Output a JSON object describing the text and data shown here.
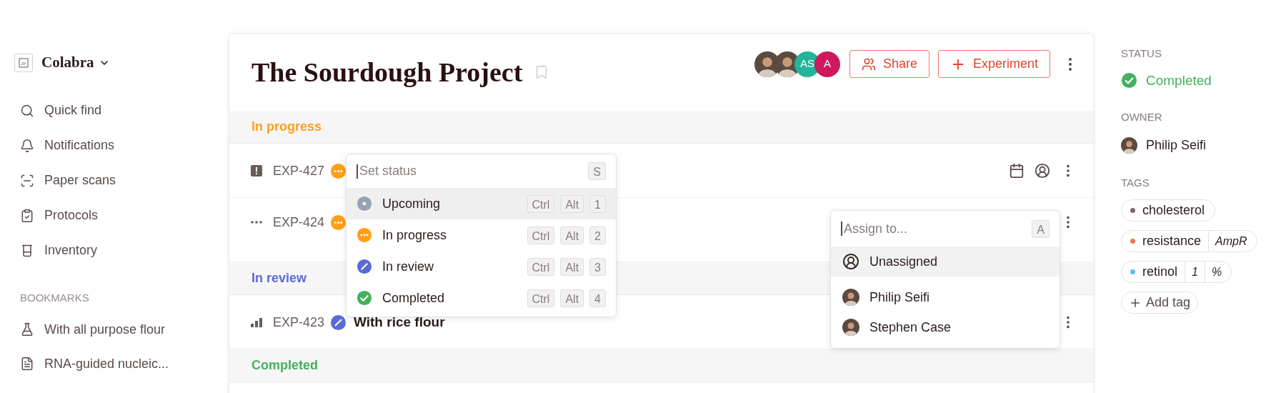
{
  "sidebar": {
    "workspace": "Colabra",
    "nav": [
      {
        "kind": "search",
        "label": "Quick find"
      },
      {
        "kind": "bell",
        "label": "Notifications"
      },
      {
        "kind": "scan",
        "label": "Paper scans"
      },
      {
        "kind": "clipboard",
        "label": "Protocols"
      },
      {
        "kind": "beaker",
        "label": "Inventory"
      }
    ],
    "bookmarks_heading": "BOOKMARKS",
    "bookmarks": [
      {
        "kind": "experiment",
        "label": "With all purpose flour"
      },
      {
        "kind": "document",
        "label": "RNA-guided nucleic..."
      }
    ]
  },
  "project": {
    "title": "The Sourdough Project",
    "bookmarked": false,
    "members": [
      {
        "kind": "photo"
      },
      {
        "kind": "photo"
      },
      {
        "kind": "initials",
        "initials": "AS",
        "color": "#22b59b"
      },
      {
        "kind": "initials",
        "initials": "A",
        "color": "#d0185f"
      }
    ],
    "buttons": [
      {
        "kind": "share",
        "label": "Share"
      },
      {
        "kind": "add",
        "label": "Experiment"
      }
    ]
  },
  "groups": [
    {
      "label": "In progress",
      "color": "#ff9f1a",
      "experiments": [
        {
          "priority": {
            "kind": "urgent"
          },
          "id": "EXP-427",
          "status": {
            "kind": "in_progress"
          },
          "quick_actions": true
        },
        {
          "priority": {
            "kind": "none"
          },
          "id": "EXP-424",
          "status": {
            "kind": "in_progress"
          }
        }
      ]
    },
    {
      "label": "In review",
      "color": "#5b6bd6",
      "experiments": [
        {
          "priority": {
            "kind": "medium"
          },
          "id": "EXP-423",
          "status": {
            "kind": "in_review"
          },
          "title": "With rice flour"
        }
      ]
    },
    {
      "label": "Completed",
      "color": "#43b05c"
    }
  ],
  "status_menu": {
    "placeholder": "Set status",
    "shortcut": "S",
    "options": [
      {
        "kind": "upcoming",
        "label": "Upcoming",
        "selected": true,
        "keys": [
          "Ctrl",
          "Alt",
          "1"
        ]
      },
      {
        "kind": "in_progress",
        "label": "In progress",
        "selected": false,
        "keys": [
          "Ctrl",
          "Alt",
          "2"
        ]
      },
      {
        "kind": "in_review",
        "label": "In review",
        "selected": false,
        "keys": [
          "Ctrl",
          "Alt",
          "3"
        ]
      },
      {
        "kind": "completed",
        "label": "Completed",
        "selected": false,
        "keys": [
          "Ctrl",
          "Alt",
          "4"
        ]
      }
    ]
  },
  "assign_menu": {
    "placeholder": "Assign to...",
    "shortcut": "A",
    "options": [
      {
        "kind": "unassigned",
        "label": "Unassigned",
        "selected": true
      },
      {
        "kind": "person",
        "label": "Philip Seifi",
        "selected": false
      },
      {
        "kind": "person",
        "label": "Stephen Case",
        "selected": false
      }
    ]
  },
  "details": {
    "status": {
      "heading": "STATUS",
      "label": "Completed",
      "kind": "completed"
    },
    "owner": {
      "heading": "OWNER",
      "name": "Philip Seifi"
    },
    "tags": {
      "heading": "TAGS",
      "items": [
        {
          "label": "cholesterol",
          "color": "#7a6a66"
        },
        {
          "label": "resistance",
          "color": "#e9785d",
          "values": [
            "AmpR"
          ]
        },
        {
          "label": "retinol",
          "color": "#5bc0eb",
          "values": [
            "1",
            "%"
          ]
        }
      ],
      "add_label": "Add tag"
    }
  }
}
